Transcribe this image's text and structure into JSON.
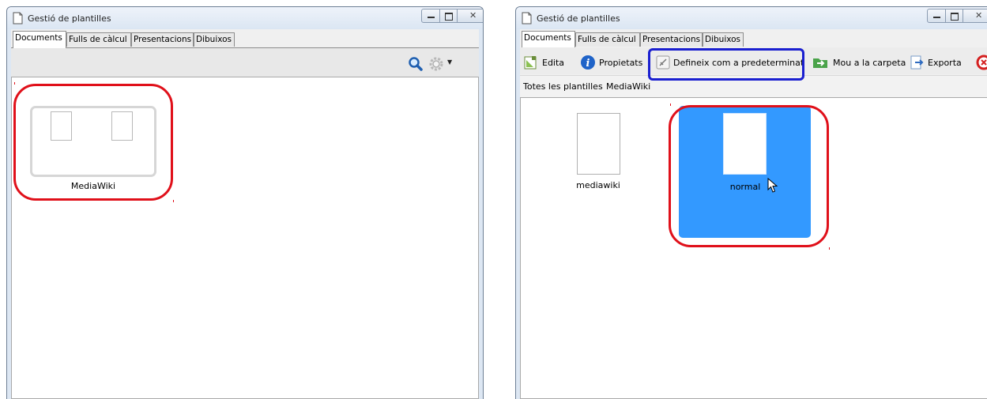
{
  "left_window": {
    "title": "Gestió de plantilles",
    "tabs": [
      "Documents",
      "Fulls de càlcul",
      "Presentacions",
      "Dibuixos"
    ],
    "active_tab": "Documents",
    "folder": {
      "label": "MediaWiki"
    }
  },
  "right_window": {
    "title": "Gestió de plantilles",
    "tabs": [
      "Documents",
      "Fulls de càlcul",
      "Presentacions",
      "Dibuixos"
    ],
    "active_tab": "Documents",
    "toolbar": {
      "edit": "Edita",
      "properties": "Propietats",
      "set_default": "Defineix com a predeterminat",
      "move_to_folder": "Mou a la carpeta",
      "export": "Exporta"
    },
    "breadcrumb": [
      "Totes les plantilles",
      "MediaWiki"
    ],
    "templates": [
      {
        "label": "mediawiki",
        "selected": false
      },
      {
        "label": "normal",
        "selected": true
      }
    ]
  },
  "colors": {
    "highlight_red": "#e0101a",
    "highlight_blue": "#1a1fd0",
    "selection": "#3399ff"
  }
}
